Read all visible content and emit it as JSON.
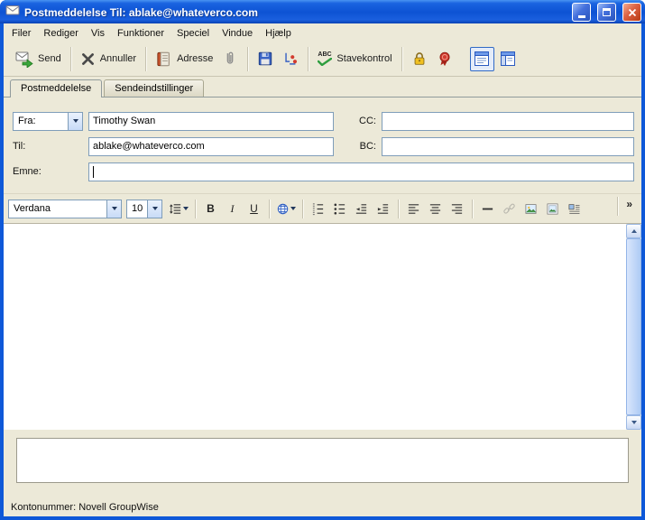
{
  "window": {
    "title": "Postmeddelelse Til: ablake@whateverco.com"
  },
  "menu": {
    "items": [
      "Filer",
      "Rediger",
      "Vis",
      "Funktioner",
      "Speciel",
      "Vindue",
      "Hjælp"
    ]
  },
  "toolbar": {
    "send_label": "Send",
    "cancel_label": "Annuller",
    "address_label": "Adresse",
    "spellcheck_label": "Stavekontrol",
    "abc_label": "ABC"
  },
  "tabs": [
    {
      "label": "Postmeddelelse",
      "active": true
    },
    {
      "label": "Sendeindstillinger",
      "active": false
    }
  ],
  "form": {
    "from_label": "Fra:",
    "from_value": "Timothy Swan",
    "to_label": "Til:",
    "to_value": "ablake@whateverco.com",
    "cc_label": "CC:",
    "cc_value": "",
    "bc_label": "BC:",
    "bc_value": "",
    "subject_label": "Emne:",
    "subject_value": ""
  },
  "format_toolbar": {
    "font_name": "Verdana",
    "font_size": "10",
    "bold_label": "B",
    "italic_label": "I",
    "underline_label": "U",
    "overflow_label": "»"
  },
  "statusbar": {
    "text": "Kontonummer: Novell GroupWise"
  },
  "colors": {
    "titlebar_blue": "#0D53D4",
    "face": "#ECE9D8",
    "input_border": "#7F9DB9",
    "close_red": "#D75532",
    "send_green": "#3BA53B"
  }
}
